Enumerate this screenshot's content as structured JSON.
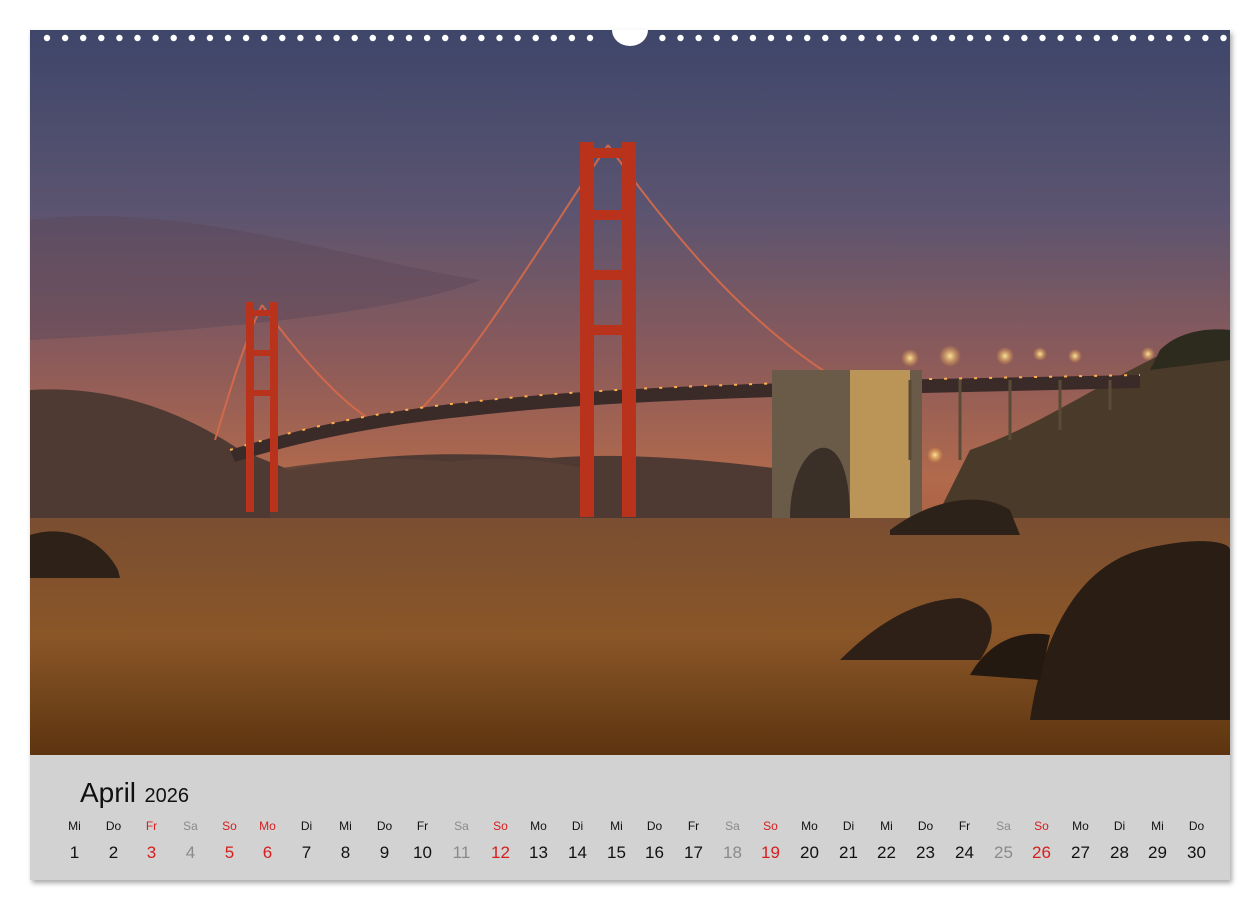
{
  "calendar": {
    "month": "April",
    "year": "2026",
    "days": [
      {
        "weekday": "Mi",
        "day": "1",
        "type": "normal"
      },
      {
        "weekday": "Do",
        "day": "2",
        "type": "normal"
      },
      {
        "weekday": "Fr",
        "day": "3",
        "type": "hol"
      },
      {
        "weekday": "Sa",
        "day": "4",
        "type": "sat"
      },
      {
        "weekday": "So",
        "day": "5",
        "type": "sun"
      },
      {
        "weekday": "Mo",
        "day": "6",
        "type": "hol"
      },
      {
        "weekday": "Di",
        "day": "7",
        "type": "normal"
      },
      {
        "weekday": "Mi",
        "day": "8",
        "type": "normal"
      },
      {
        "weekday": "Do",
        "day": "9",
        "type": "normal"
      },
      {
        "weekday": "Fr",
        "day": "10",
        "type": "normal"
      },
      {
        "weekday": "Sa",
        "day": "11",
        "type": "sat"
      },
      {
        "weekday": "So",
        "day": "12",
        "type": "sun"
      },
      {
        "weekday": "Mo",
        "day": "13",
        "type": "normal"
      },
      {
        "weekday": "Di",
        "day": "14",
        "type": "normal"
      },
      {
        "weekday": "Mi",
        "day": "15",
        "type": "normal"
      },
      {
        "weekday": "Do",
        "day": "16",
        "type": "normal"
      },
      {
        "weekday": "Fr",
        "day": "17",
        "type": "normal"
      },
      {
        "weekday": "Sa",
        "day": "18",
        "type": "sat"
      },
      {
        "weekday": "So",
        "day": "19",
        "type": "sun"
      },
      {
        "weekday": "Mo",
        "day": "20",
        "type": "normal"
      },
      {
        "weekday": "Di",
        "day": "21",
        "type": "normal"
      },
      {
        "weekday": "Mi",
        "day": "22",
        "type": "normal"
      },
      {
        "weekday": "Do",
        "day": "23",
        "type": "normal"
      },
      {
        "weekday": "Fr",
        "day": "24",
        "type": "normal"
      },
      {
        "weekday": "Sa",
        "day": "25",
        "type": "sat"
      },
      {
        "weekday": "So",
        "day": "26",
        "type": "sun"
      },
      {
        "weekday": "Mo",
        "day": "27",
        "type": "normal"
      },
      {
        "weekday": "Di",
        "day": "28",
        "type": "normal"
      },
      {
        "weekday": "Mi",
        "day": "29",
        "type": "normal"
      },
      {
        "weekday": "Do",
        "day": "30",
        "type": "normal"
      }
    ]
  },
  "colors": {
    "holiday": "#d51e1e",
    "saturday": "#8a8a8a",
    "strip": "#d2d2d2",
    "bridge": "#b8321c"
  }
}
